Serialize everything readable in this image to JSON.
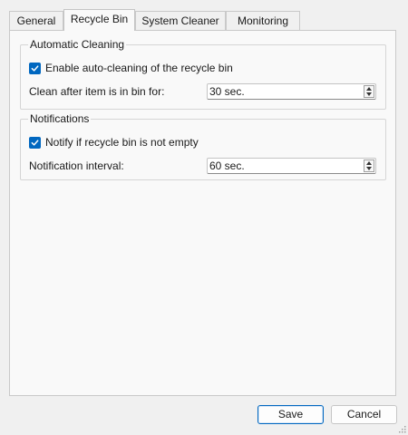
{
  "tabs": [
    {
      "label": "General"
    },
    {
      "label": "Recycle Bin",
      "active": true
    },
    {
      "label": "System Cleaner"
    },
    {
      "label": "Monitoring"
    }
  ],
  "automatic_cleaning": {
    "title": "Automatic Cleaning",
    "enable_label": "Enable auto-cleaning of the recycle bin",
    "enable_checked": true,
    "clean_after_label": "Clean after item is in bin for:",
    "clean_after_value": "30 sec."
  },
  "notifications": {
    "title": "Notifications",
    "notify_label": "Notify if recycle bin is not empty",
    "notify_checked": true,
    "interval_label": "Notification interval:",
    "interval_value": "60 sec."
  },
  "buttons": {
    "save": "Save",
    "cancel": "Cancel"
  },
  "colors": {
    "accent": "#0067c0"
  }
}
